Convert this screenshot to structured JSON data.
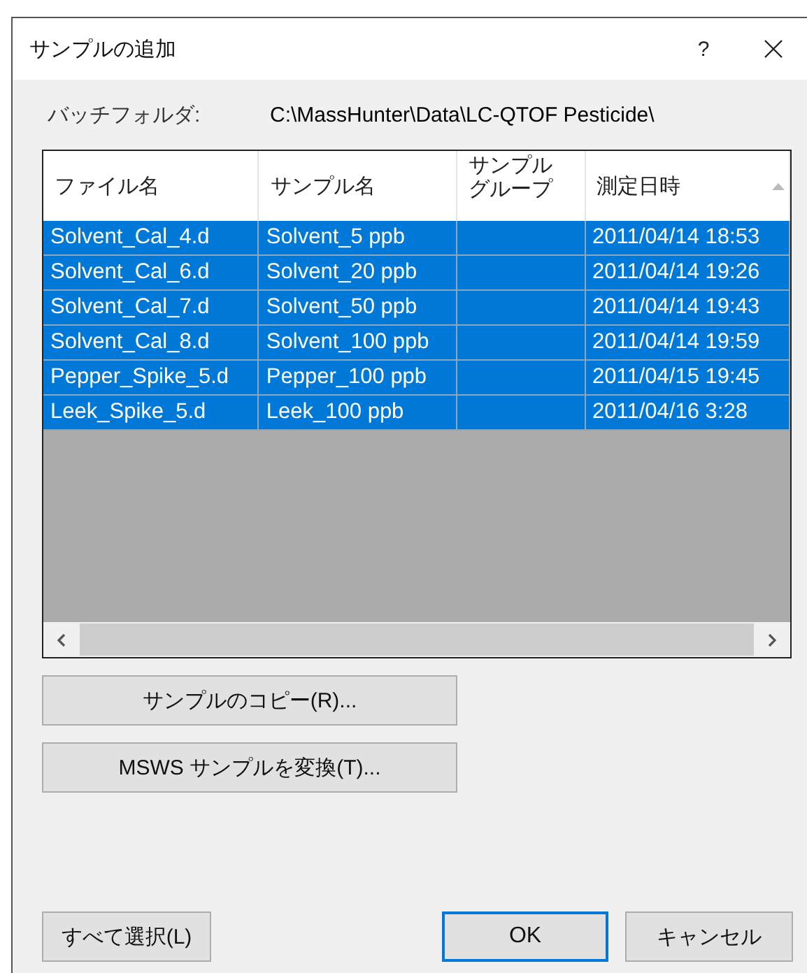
{
  "window": {
    "title": "サンプルの追加",
    "help": "?"
  },
  "batch_folder": {
    "label": "バッチフォルダ:",
    "value": "C:\\MassHunter\\Data\\LC-QTOF Pesticide\\"
  },
  "table": {
    "columns": [
      {
        "label": "ファイル名",
        "sorted": false
      },
      {
        "label": "サンプル名",
        "sorted": false
      },
      {
        "label": "サンプルグループ",
        "sorted": false
      },
      {
        "label": "測定日時",
        "sorted": true
      }
    ],
    "rows": [
      {
        "cells": [
          "Solvent_Cal_4.d",
          "Solvent_5 ppb",
          "",
          "2011/04/14 18:53"
        ],
        "selected": true
      },
      {
        "cells": [
          "Solvent_Cal_6.d",
          "Solvent_20 ppb",
          "",
          "2011/04/14 19:26"
        ],
        "selected": true
      },
      {
        "cells": [
          "Solvent_Cal_7.d",
          "Solvent_50 ppb",
          "",
          "2011/04/14 19:43"
        ],
        "selected": true
      },
      {
        "cells": [
          "Solvent_Cal_8.d",
          "Solvent_100 ppb",
          "",
          "2011/04/14 19:59"
        ],
        "selected": true
      },
      {
        "cells": [
          "Pepper_Spike_5.d",
          "Pepper_100 ppb",
          "",
          "2011/04/15 19:45"
        ],
        "selected": true
      },
      {
        "cells": [
          "Leek_Spike_5.d",
          "Leek_100 ppb",
          "",
          "2011/04/16 3:28"
        ],
        "selected": true
      }
    ]
  },
  "side_buttons": [
    {
      "label": "サンプルのコピー(R)..."
    },
    {
      "label": "MSWS サンプルを変換(T)..."
    }
  ],
  "footer_buttons": [
    {
      "label": "すべて選択(L)",
      "default": false
    },
    {
      "label": "OK",
      "default": true
    },
    {
      "label": "キャンセル",
      "default": false
    }
  ]
}
